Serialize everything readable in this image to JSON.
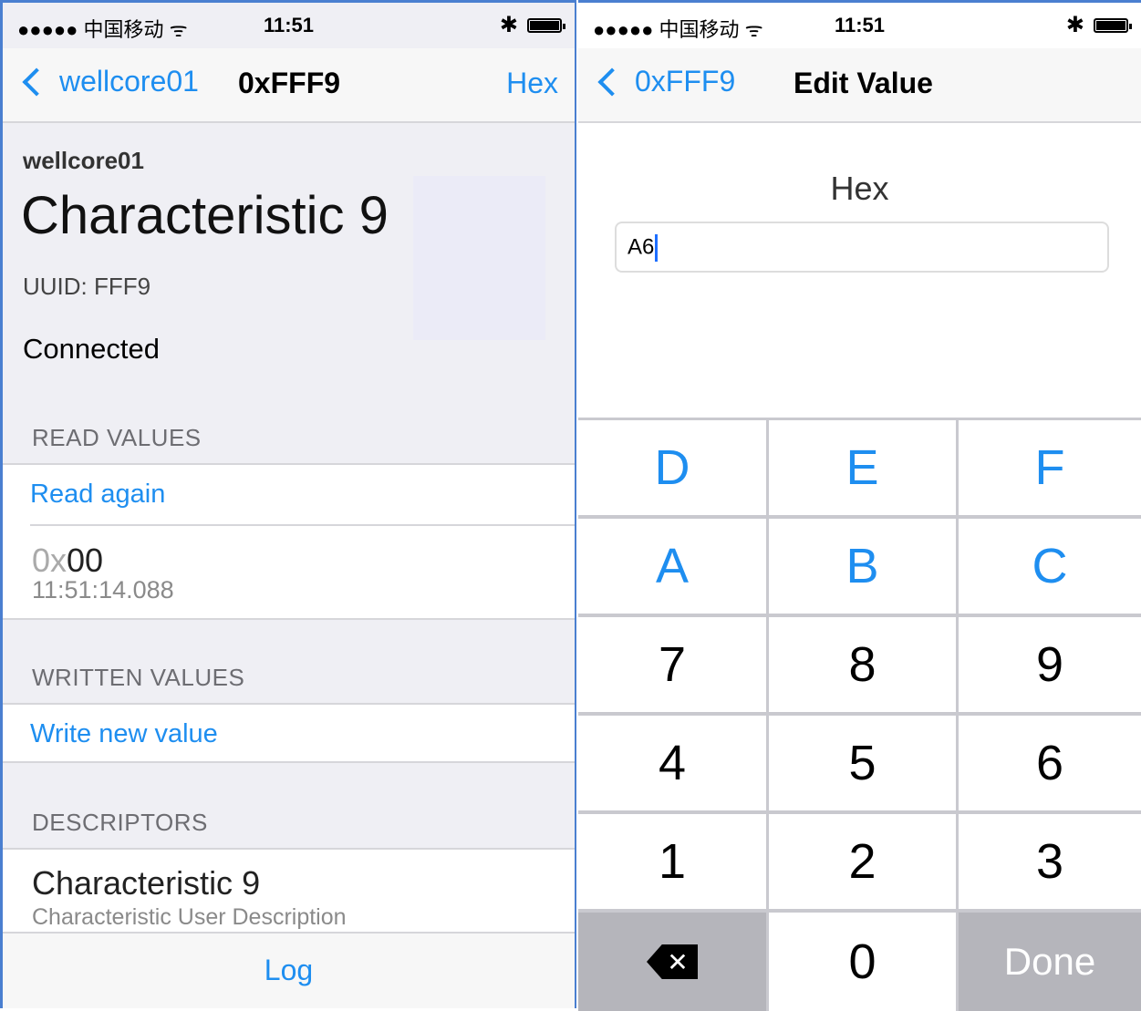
{
  "left": {
    "status": {
      "carrier": "●●●●● 中国移动 ᯤ",
      "time": "11:51",
      "bluetooth": "✱"
    },
    "nav": {
      "back_label": "wellcore01",
      "title": "0xFFF9",
      "right_label": "Hex"
    },
    "header": {
      "device": "wellcore01",
      "characteristic": "Characteristic 9",
      "uuid": "UUID: FFF9",
      "status": "Connected"
    },
    "read_values": {
      "header": "READ VALUES",
      "action": "Read again",
      "value_prefix": "0x",
      "value": "00",
      "timestamp": "11:51:14.088"
    },
    "written_values": {
      "header": "WRITTEN VALUES",
      "action": "Write new value"
    },
    "descriptors": {
      "header": "DESCRIPTORS",
      "title": "Characteristic 9",
      "subtitle": "Characteristic User Description"
    },
    "toolbar": {
      "log_label": "Log"
    }
  },
  "right": {
    "status": {
      "carrier": "●●●●● 中国移动 ᯤ",
      "time": "11:51",
      "bluetooth": "✱"
    },
    "nav": {
      "back_label": "0xFFF9",
      "title": "Edit Value"
    },
    "field": {
      "label": "Hex",
      "value": "A6"
    },
    "keys": {
      "row1": [
        "D",
        "E",
        "F"
      ],
      "row2": [
        "A",
        "B",
        "C"
      ],
      "row3": [
        "7",
        "8",
        "9"
      ],
      "row4": [
        "4",
        "5",
        "6"
      ],
      "row5": [
        "1",
        "2",
        "3"
      ],
      "zero": "0",
      "delete_symbol": "✕",
      "done": "Done"
    }
  },
  "colors": {
    "accent": "#1e8ef0",
    "group_bg": "#efeff4",
    "key_dark": "#b5b5bb"
  }
}
